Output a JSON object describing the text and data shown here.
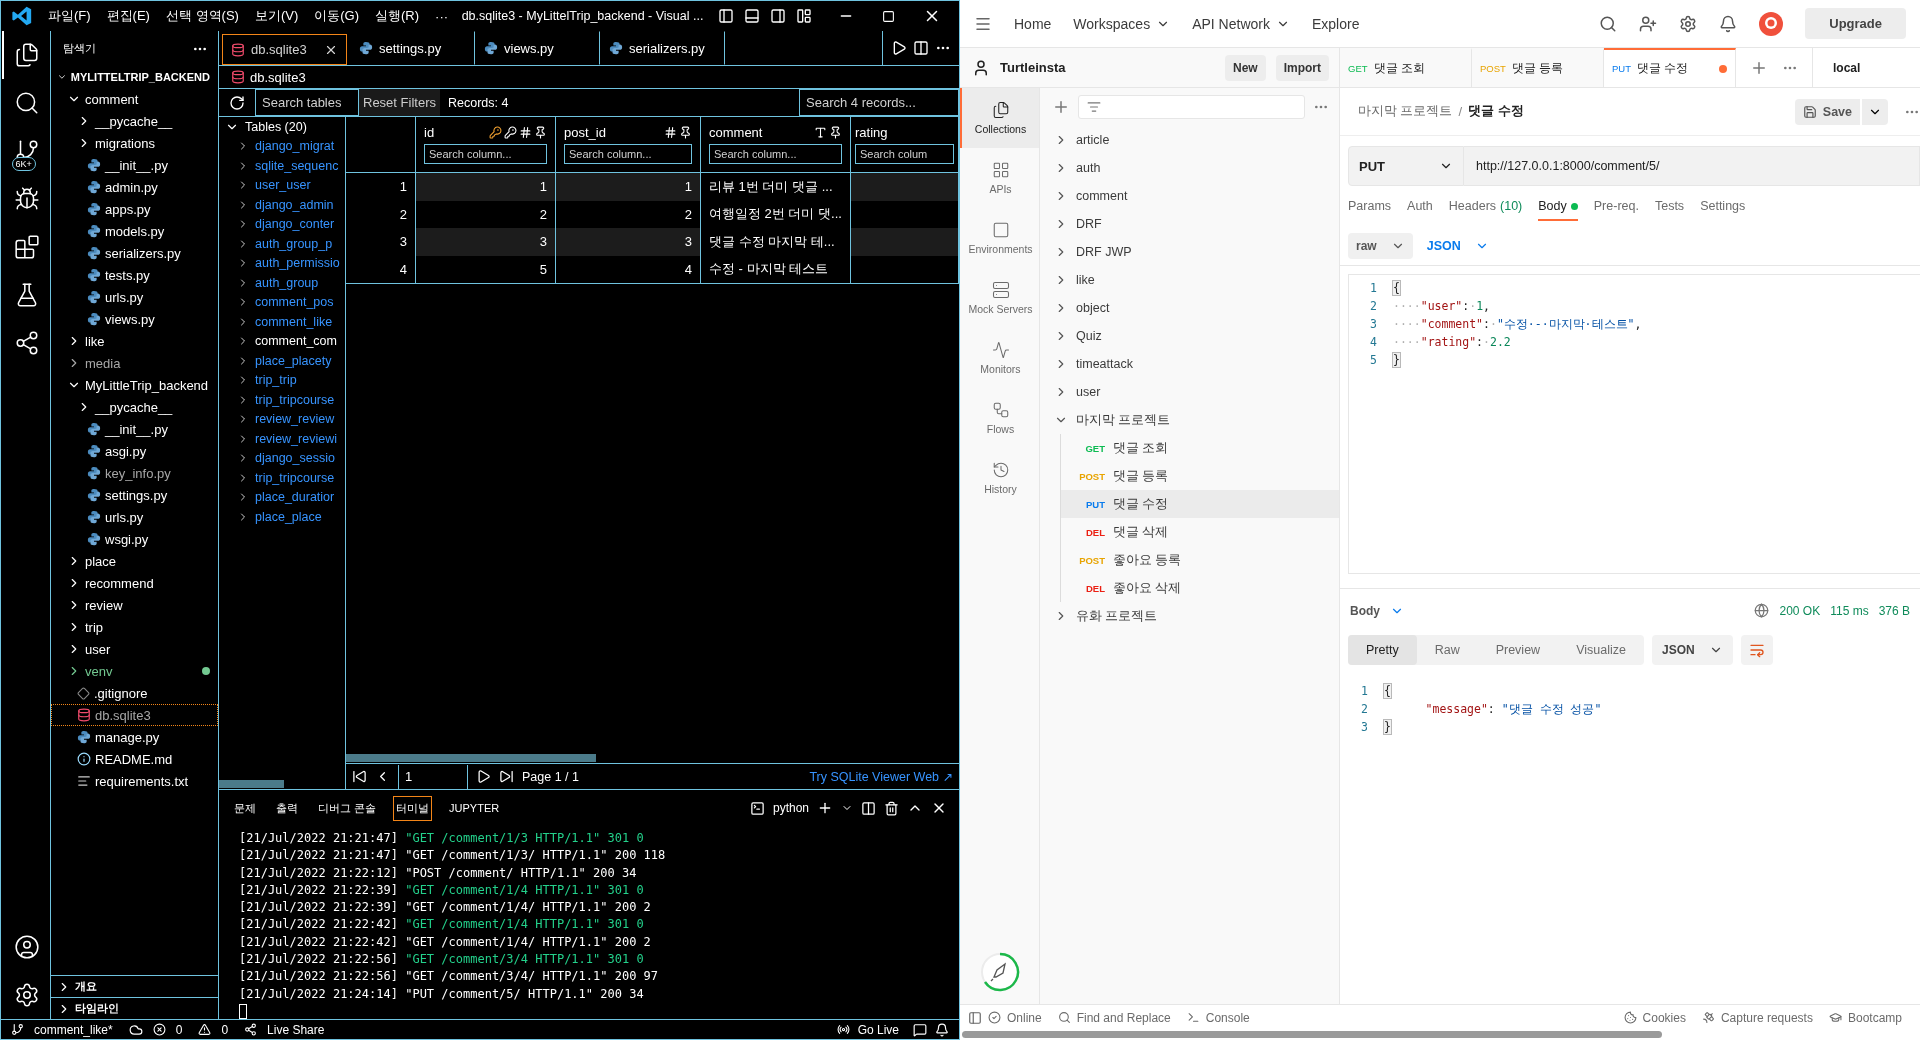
{
  "vscode": {
    "menu": [
      "파일(F)",
      "편집(E)",
      "선택 영역(S)",
      "보기(V)",
      "이동(G)",
      "실행(R)",
      "···"
    ],
    "title": "db.sqlite3 - MyLittelTrip_backend - Visual ...",
    "activity": [
      {
        "kind": "explorer",
        "selected": true
      },
      {
        "kind": "search",
        "selected": false
      },
      {
        "kind": "source-control",
        "selected": false,
        "badge": "6K+"
      },
      {
        "kind": "run",
        "selected": false
      },
      {
        "kind": "extensions",
        "selected": false
      },
      {
        "kind": "testing",
        "selected": false
      },
      {
        "kind": "live-share",
        "selected": false
      }
    ],
    "activity_bottom": [
      {
        "kind": "account"
      },
      {
        "kind": "manage"
      }
    ],
    "explorer": {
      "title": "탐색기",
      "tree": [
        {
          "name": "MYLITTELTRIP_BACKEND",
          "kind": "root",
          "expanded": true,
          "selected": false,
          "children": [
            {
              "name": "comment",
              "kind": "folder",
              "expanded": true,
              "selected": false,
              "children": [
                {
                  "name": "__pycache__",
                  "kind": "folder",
                  "expanded": false,
                  "selected": false
                },
                {
                  "name": "migrations",
                  "kind": "folder",
                  "expanded": false,
                  "selected": false
                },
                {
                  "name": "__init__.py",
                  "kind": "python",
                  "selected": false
                },
                {
                  "name": "admin.py",
                  "kind": "python",
                  "selected": false
                },
                {
                  "name": "apps.py",
                  "kind": "python",
                  "selected": false
                },
                {
                  "name": "models.py",
                  "kind": "python",
                  "selected": false
                },
                {
                  "name": "serializers.py",
                  "kind": "python",
                  "selected": false
                },
                {
                  "name": "tests.py",
                  "kind": "python",
                  "selected": false
                },
                {
                  "name": "urls.py",
                  "kind": "python",
                  "selected": false
                },
                {
                  "name": "views.py",
                  "kind": "python",
                  "selected": false
                }
              ]
            },
            {
              "name": "like",
              "kind": "folder",
              "expanded": false,
              "selected": false
            },
            {
              "name": "media",
              "kind": "folder",
              "expanded": false,
              "selected": false,
              "ignored": true
            },
            {
              "name": "MyLittleTrip_backend",
              "kind": "folder",
              "expanded": true,
              "selected": false,
              "children": [
                {
                  "name": "__pycache__",
                  "kind": "folder",
                  "expanded": false,
                  "selected": false
                },
                {
                  "name": "__init__.py",
                  "kind": "python",
                  "selected": false
                },
                {
                  "name": "asgi.py",
                  "kind": "python",
                  "selected": false
                },
                {
                  "name": "key_info.py",
                  "kind": "python",
                  "selected": false,
                  "ignored": true
                },
                {
                  "name": "settings.py",
                  "kind": "python",
                  "selected": false
                },
                {
                  "name": "urls.py",
                  "kind": "python",
                  "selected": false
                },
                {
                  "name": "wsgi.py",
                  "kind": "python",
                  "selected": false
                }
              ]
            },
            {
              "name": "place",
              "kind": "folder",
              "expanded": false,
              "selected": false
            },
            {
              "name": "recommend",
              "kind": "folder",
              "expanded": false,
              "selected": false
            },
            {
              "name": "review",
              "kind": "folder",
              "expanded": false,
              "selected": false
            },
            {
              "name": "trip",
              "kind": "folder",
              "expanded": false,
              "selected": false
            },
            {
              "name": "user",
              "kind": "folder",
              "expanded": false,
              "selected": false
            },
            {
              "name": "venv",
              "kind": "folder",
              "expanded": false,
              "selected": false,
              "untracked": true
            },
            {
              "name": ".gitignore",
              "kind": "git",
              "selected": false
            },
            {
              "name": "db.sqlite3",
              "kind": "db",
              "selected": true,
              "ignored": true
            },
            {
              "name": "manage.py",
              "kind": "python",
              "selected": false
            },
            {
              "name": "README.md",
              "kind": "info",
              "selected": false
            },
            {
              "name": "requirements.txt",
              "kind": "text",
              "selected": false
            }
          ]
        }
      ],
      "sections": [
        {
          "label": "개요",
          "expanded": false
        },
        {
          "label": "타임라인",
          "expanded": false
        }
      ]
    },
    "tabs": [
      {
        "label": "db.sqlite3",
        "kind": "db",
        "selected": true
      },
      {
        "label": "settings.py",
        "kind": "python",
        "selected": false
      },
      {
        "label": "views.py",
        "kind": "python",
        "selected": false
      },
      {
        "label": "serializers.py",
        "kind": "python",
        "selected": false
      }
    ],
    "breadcrumb": "db.sqlite3",
    "viewer": {
      "table_search": {
        "placeholder": "Search tables"
      },
      "reset": "Reset Filters",
      "records": "Records: 4",
      "record_search": {
        "placeholder": "Search 4 records..."
      },
      "tables_header": "Tables (20)",
      "tables": [
        {
          "name": "django_migrat",
          "selected": false
        },
        {
          "name": "sqlite_sequenc",
          "selected": false
        },
        {
          "name": "user_user",
          "selected": false
        },
        {
          "name": "django_admin",
          "selected": false
        },
        {
          "name": "django_conter",
          "selected": false
        },
        {
          "name": "auth_group_p",
          "selected": false
        },
        {
          "name": "auth_permissio",
          "selected": false
        },
        {
          "name": "auth_group",
          "selected": false
        },
        {
          "name": "comment_pos",
          "selected": false
        },
        {
          "name": "comment_like",
          "selected": false
        },
        {
          "name": "comment_com",
          "selected": true
        },
        {
          "name": "place_placety",
          "selected": false
        },
        {
          "name": "trip_trip",
          "selected": false
        },
        {
          "name": "trip_tripcourse",
          "selected": false
        },
        {
          "name": "review_review",
          "selected": false
        },
        {
          "name": "review_reviewi",
          "selected": false
        },
        {
          "name": "django_sessio",
          "selected": false
        },
        {
          "name": "trip_tripcourse",
          "selected": false
        },
        {
          "name": "place_duratior",
          "selected": false
        },
        {
          "name": "place_place",
          "selected": false
        }
      ],
      "columns": [
        {
          "name": "id",
          "kind": "number",
          "marks": [
            {
              "kind": "primary-key"
            },
            {
              "kind": "key"
            },
            {
              "kind": "number"
            },
            {
              "kind": "pin"
            }
          ],
          "placeholder": "Search column..."
        },
        {
          "name": "post_id",
          "kind": "number",
          "marks": [
            {
              "kind": "number"
            },
            {
              "kind": "pin"
            }
          ],
          "placeholder": "Search column..."
        },
        {
          "name": "comment",
          "kind": "text",
          "marks": [
            {
              "kind": "text"
            },
            {
              "kind": "pin"
            }
          ],
          "placeholder": "Search column..."
        },
        {
          "name": "rating",
          "kind": "number",
          "placeholder": "Search colum"
        }
      ],
      "rows": [
        {
          "number": "1",
          "cells": [
            "1",
            "1",
            "리뷰 1번 더미 댓글 ..."
          ]
        },
        {
          "number": "2",
          "cells": [
            "2",
            "2",
            "여행일정 2번 더미 댓..."
          ]
        },
        {
          "number": "3",
          "cells": [
            "3",
            "3",
            "댓글 수정 마지막 테..."
          ]
        },
        {
          "number": "4",
          "cells": [
            "5",
            "4",
            "수정 - 마지막 테스트"
          ]
        }
      ],
      "page_input": "1",
      "page": "Page 1 / 1",
      "web_link": "Try SQLite Viewer Web ↗"
    },
    "panel": {
      "tabs": [
        {
          "label": "문제",
          "selected": false
        },
        {
          "label": "출력",
          "selected": false
        },
        {
          "label": "디버그 콘솔",
          "selected": false
        },
        {
          "label": "터미널",
          "selected": true
        },
        {
          "label": "JUPYTER",
          "selected": false
        }
      ],
      "terminal": "python",
      "lines": [
        {
          "time": "[21/Jul/2022 21:21:47]",
          "request": "\"GET /comment/1/3 HTTP/1.1\" 301 0",
          "redirect": true
        },
        {
          "time": "[21/Jul/2022 21:21:47]",
          "request": "\"GET /comment/1/3/ HTTP/1.1\" 200 118",
          "redirect": false
        },
        {
          "time": "[21/Jul/2022 21:22:12]",
          "request": "\"POST /comment/ HTTP/1.1\" 200 34",
          "redirect": false
        },
        {
          "time": "[21/Jul/2022 21:22:39]",
          "request": "\"GET /comment/1/4 HTTP/1.1\" 301 0",
          "redirect": true
        },
        {
          "time": "[21/Jul/2022 21:22:39]",
          "request": "\"GET /comment/1/4/ HTTP/1.1\" 200 2",
          "redirect": false
        },
        {
          "time": "[21/Jul/2022 21:22:42]",
          "request": "\"GET /comment/1/4 HTTP/1.1\" 301 0",
          "redirect": true
        },
        {
          "time": "[21/Jul/2022 21:22:42]",
          "request": "\"GET /comment/1/4/ HTTP/1.1\" 200 2",
          "redirect": false
        },
        {
          "time": "[21/Jul/2022 21:22:56]",
          "request": "\"GET /comment/3/4 HTTP/1.1\" 301 0",
          "redirect": true
        },
        {
          "time": "[21/Jul/2022 21:22:56]",
          "request": "\"GET /comment/3/4/ HTTP/1.1\" 200 97",
          "redirect": false
        },
        {
          "time": "[21/Jul/2022 21:24:14]",
          "request": "\"PUT /comment/5/ HTTP/1.1\" 200 34",
          "redirect": false
        }
      ]
    },
    "status": {
      "branch": "comment_like*",
      "errors": "0",
      "warnings": "0",
      "live_share": "Live Share",
      "go_live": "Go Live"
    }
  },
  "postman": {
    "nav": [
      {
        "label": "Home",
        "dropdown": false
      },
      {
        "label": "Workspaces",
        "dropdown": true
      },
      {
        "label": "API Network",
        "dropdown": true
      },
      {
        "label": "Explore",
        "dropdown": false
      }
    ],
    "upgrade": "Upgrade",
    "workspace": {
      "name": "Turtleinsta",
      "buttons": [
        "New",
        "Import"
      ]
    },
    "rail": [
      {
        "label": "Collections",
        "kind": "collections",
        "selected": true
      },
      {
        "label": "APIs",
        "kind": "apis",
        "selected": false
      },
      {
        "label": "Environments",
        "kind": "environments",
        "selected": false
      },
      {
        "label": "Mock Servers",
        "kind": "mock",
        "selected": false
      },
      {
        "label": "Monitors",
        "kind": "monitors",
        "selected": false
      },
      {
        "label": "Flows",
        "kind": "flows",
        "selected": false
      },
      {
        "label": "History",
        "kind": "history",
        "selected": false
      }
    ],
    "collections": [
      {
        "name": "article",
        "expanded": false
      },
      {
        "name": "auth",
        "expanded": false
      },
      {
        "name": "comment",
        "expanded": false
      },
      {
        "name": "DRF",
        "expanded": false
      },
      {
        "name": "DRF JWP",
        "expanded": false
      },
      {
        "name": "like",
        "expanded": false
      },
      {
        "name": "object",
        "expanded": false
      },
      {
        "name": "Quiz",
        "expanded": false
      },
      {
        "name": "timeattack",
        "expanded": false
      },
      {
        "name": "user",
        "expanded": false
      },
      {
        "name": "마지막 프로젝트",
        "expanded": true,
        "requests": [
          {
            "method": "GET",
            "name": "댓글 조회",
            "selected": false
          },
          {
            "method": "POST",
            "name": "댓글 등록",
            "selected": false
          },
          {
            "method": "PUT",
            "name": "댓글 수정",
            "selected": true
          },
          {
            "method": "DEL",
            "name": "댓글 삭제",
            "selected": false
          },
          {
            "method": "POST",
            "name": "좋아요 등록",
            "selected": false
          },
          {
            "method": "DEL",
            "name": "좋아요 삭제",
            "selected": false
          }
        ]
      },
      {
        "name": "유화 프로젝트",
        "expanded": false
      }
    ],
    "tabs": [
      {
        "method": "GET",
        "name": "댓글 조회",
        "selected": false,
        "unsaved": false
      },
      {
        "method": "POST",
        "name": "댓글 등록",
        "selected": false,
        "unsaved": false
      },
      {
        "method": "PUT",
        "name": "댓글 수정",
        "selected": true,
        "unsaved": true
      }
    ],
    "environment": "local",
    "breadcrumb": {
      "parent": "마지막 프로젝트",
      "separator": "/",
      "current": "댓글 수정"
    },
    "save": "Save",
    "request": {
      "method": "PUT",
      "url": "http://127.0.0.1:8000/comment/5/"
    },
    "request_tabs": [
      {
        "label": "Params",
        "selected": false
      },
      {
        "label": "Auth",
        "selected": false
      },
      {
        "label": "Headers",
        "count": "(10)",
        "selected": false
      },
      {
        "label": "Body",
        "selected": true,
        "indicator": true
      },
      {
        "label": "Pre-req.",
        "selected": false
      },
      {
        "label": "Tests",
        "selected": false
      },
      {
        "label": "Settings",
        "selected": false
      }
    ],
    "body_mode": "raw",
    "body_language": "JSON",
    "body_lines": [
      {
        "number": "1",
        "tokens": [
          {
            "kind": "brace",
            "s": "{"
          }
        ]
      },
      {
        "number": "2",
        "tokens": [
          {
            "kind": "ws",
            "s": "····"
          },
          {
            "kind": "key",
            "s": "\"user\""
          },
          {
            "kind": "punct",
            "s": ":"
          },
          {
            "kind": "ws",
            "s": "·"
          },
          {
            "kind": "number",
            "s": "1"
          },
          {
            "kind": "punct",
            "s": ","
          }
        ]
      },
      {
        "number": "3",
        "tokens": [
          {
            "kind": "ws",
            "s": "····"
          },
          {
            "kind": "key",
            "s": "\"comment\""
          },
          {
            "kind": "punct",
            "s": ":"
          },
          {
            "kind": "ws",
            "s": "·"
          },
          {
            "kind": "string",
            "s": "\"수정·-·마지막·테스트\""
          },
          {
            "kind": "punct",
            "s": ","
          }
        ]
      },
      {
        "number": "4",
        "tokens": [
          {
            "kind": "ws",
            "s": "····"
          },
          {
            "kind": "key",
            "s": "\"rating\""
          },
          {
            "kind": "punct",
            "s": ":"
          },
          {
            "kind": "ws",
            "s": "·"
          },
          {
            "kind": "number",
            "s": "2.2"
          }
        ]
      },
      {
        "number": "5",
        "tokens": [
          {
            "kind": "brace",
            "s": "}"
          }
        ]
      }
    ],
    "response": {
      "label": "Body",
      "status": "200 OK",
      "time": "115 ms",
      "size": "376 B",
      "views": [
        {
          "label": "Pretty",
          "selected": true
        },
        {
          "label": "Raw",
          "selected": false
        },
        {
          "label": "Preview",
          "selected": false
        },
        {
          "label": "Visualize",
          "selected": false
        }
      ],
      "format": "JSON",
      "lines": [
        {
          "number": "1",
          "tokens": [
            {
              "kind": "brace",
              "s": "{"
            }
          ]
        },
        {
          "number": "2",
          "tokens": [
            {
              "kind": "key",
              "s": "\"message\""
            },
            {
              "kind": "punct",
              "s": ": "
            },
            {
              "kind": "string",
              "s": "\"댓글 수정 성공\""
            }
          ]
        },
        {
          "number": "3",
          "tokens": [
            {
              "kind": "brace",
              "s": "}"
            }
          ]
        }
      ]
    },
    "footer": {
      "left": [
        {
          "label": "Online",
          "kind": "online"
        },
        {
          "label": "Find and Replace",
          "kind": "find"
        },
        {
          "label": "Console",
          "kind": "console"
        }
      ],
      "right": [
        {
          "label": "Cookies",
          "kind": "cookies"
        },
        {
          "label": "Capture requests",
          "kind": "capture"
        },
        {
          "label": "Bootcamp",
          "kind": "bootcamp"
        }
      ]
    }
  }
}
